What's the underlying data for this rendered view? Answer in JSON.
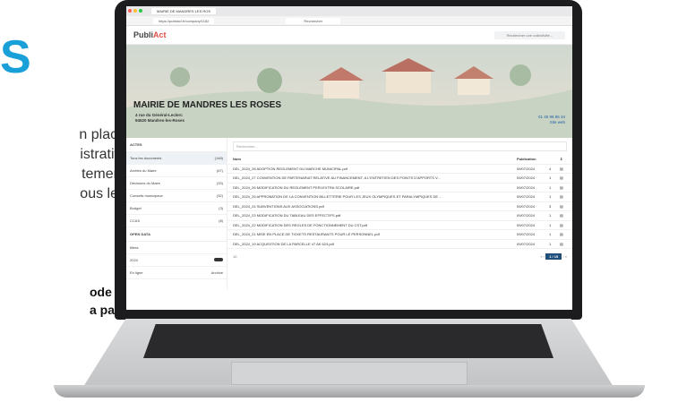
{
  "marketing": {
    "big_letter": "S",
    "lines": [
      "n place",
      "istratifs",
      "tement",
      "ous les"
    ],
    "bold_lines": [
      "ode",
      "a page"
    ]
  },
  "browser": {
    "tab_title": "MAIRIE DE MANDRES LES ROS",
    "url": "https://publiact.fr/company/1182",
    "search_placeholder": "Rechercher"
  },
  "app": {
    "logo_prefix": "Publi",
    "logo_suffix": "Act",
    "search_placeholder": "Rechercher une collectivité..."
  },
  "hero": {
    "title": "MAIRIE DE MANDRES LES ROSES",
    "address_line1": "4 rue du Général-Leclerc",
    "address_line2": "94520 Mandres-les-Roses",
    "phone": "01 45 98 86 34",
    "website": "Site web"
  },
  "sidebar": {
    "section_actes": "ACTES",
    "items": [
      {
        "label": "Tous les documents",
        "count": "(148)"
      },
      {
        "label": "Arrêtés du Maire",
        "count": "(67)"
      },
      {
        "label": "Décisions du Maire",
        "count": "(33)"
      },
      {
        "label": "Conseils municipaux",
        "count": "(32)"
      },
      {
        "label": "Budget",
        "count": "(3)"
      },
      {
        "label": "CCAS",
        "count": "(8)"
      }
    ],
    "section_open_data": "OPEN DATA",
    "filter_label": "filtres",
    "year": "2024",
    "status_online": "En ligne",
    "status_archived": "Archivé"
  },
  "table": {
    "search_placeholder": "Rechercher...",
    "col_name": "Nom",
    "col_publication": "Publication",
    "rows": [
      {
        "name": "DEL_2024_28 ADOPTION REGLEMENT DU MARCHE MUNICIPAL.pdf",
        "date": "09/07/2024",
        "count": "4"
      },
      {
        "name": "DEL_2024_27 CONVENTION DE PARTENARIAT RELATIVE AU FINANCEMENT, A L'ENTRETIEN DES POINTS D'APPORTS V...",
        "date": "09/07/2024",
        "count": "1"
      },
      {
        "name": "DEL_2024_26 MODIFICATION DU REGLEMENT PERI-EXTRA SCOLAIRE.pdf",
        "date": "09/07/2024",
        "count": "1"
      },
      {
        "name": "DEL_2024_25 APPROBATION DE LA CONVENTION BILLETTERIE POUR LES JEUX OLYMPIQUES ET PARALYMPIQUES DE ...",
        "date": "09/07/2024",
        "count": "1"
      },
      {
        "name": "DEL_2024_24 SUBVENTIONS AUX ASSOCIATIONS.pdf",
        "date": "09/07/2024",
        "count": "3"
      },
      {
        "name": "DEL_2024_23 MODIFICATION DU TABLEAU DES EFFECTIFS.pdf",
        "date": "09/07/2024",
        "count": "1"
      },
      {
        "name": "DEL_2024_22 MODIFICATION DES REGLES DE FONCTIONNEMENT DU CST.pdf",
        "date": "09/07/2024",
        "count": "1"
      },
      {
        "name": "DEL_2024_21 MISE EN PLACE DE TICKETS RESTAURANTS POUR LE PERSONNEL.pdf",
        "date": "09/07/2024",
        "count": "1"
      },
      {
        "name": "DEL_2024_19 ACQUISITION DE LA PARCELLE 47 AK 624.pdf",
        "date": "09/07/2024",
        "count": "1"
      }
    ],
    "page_size": "10",
    "page": "1 / 15"
  }
}
